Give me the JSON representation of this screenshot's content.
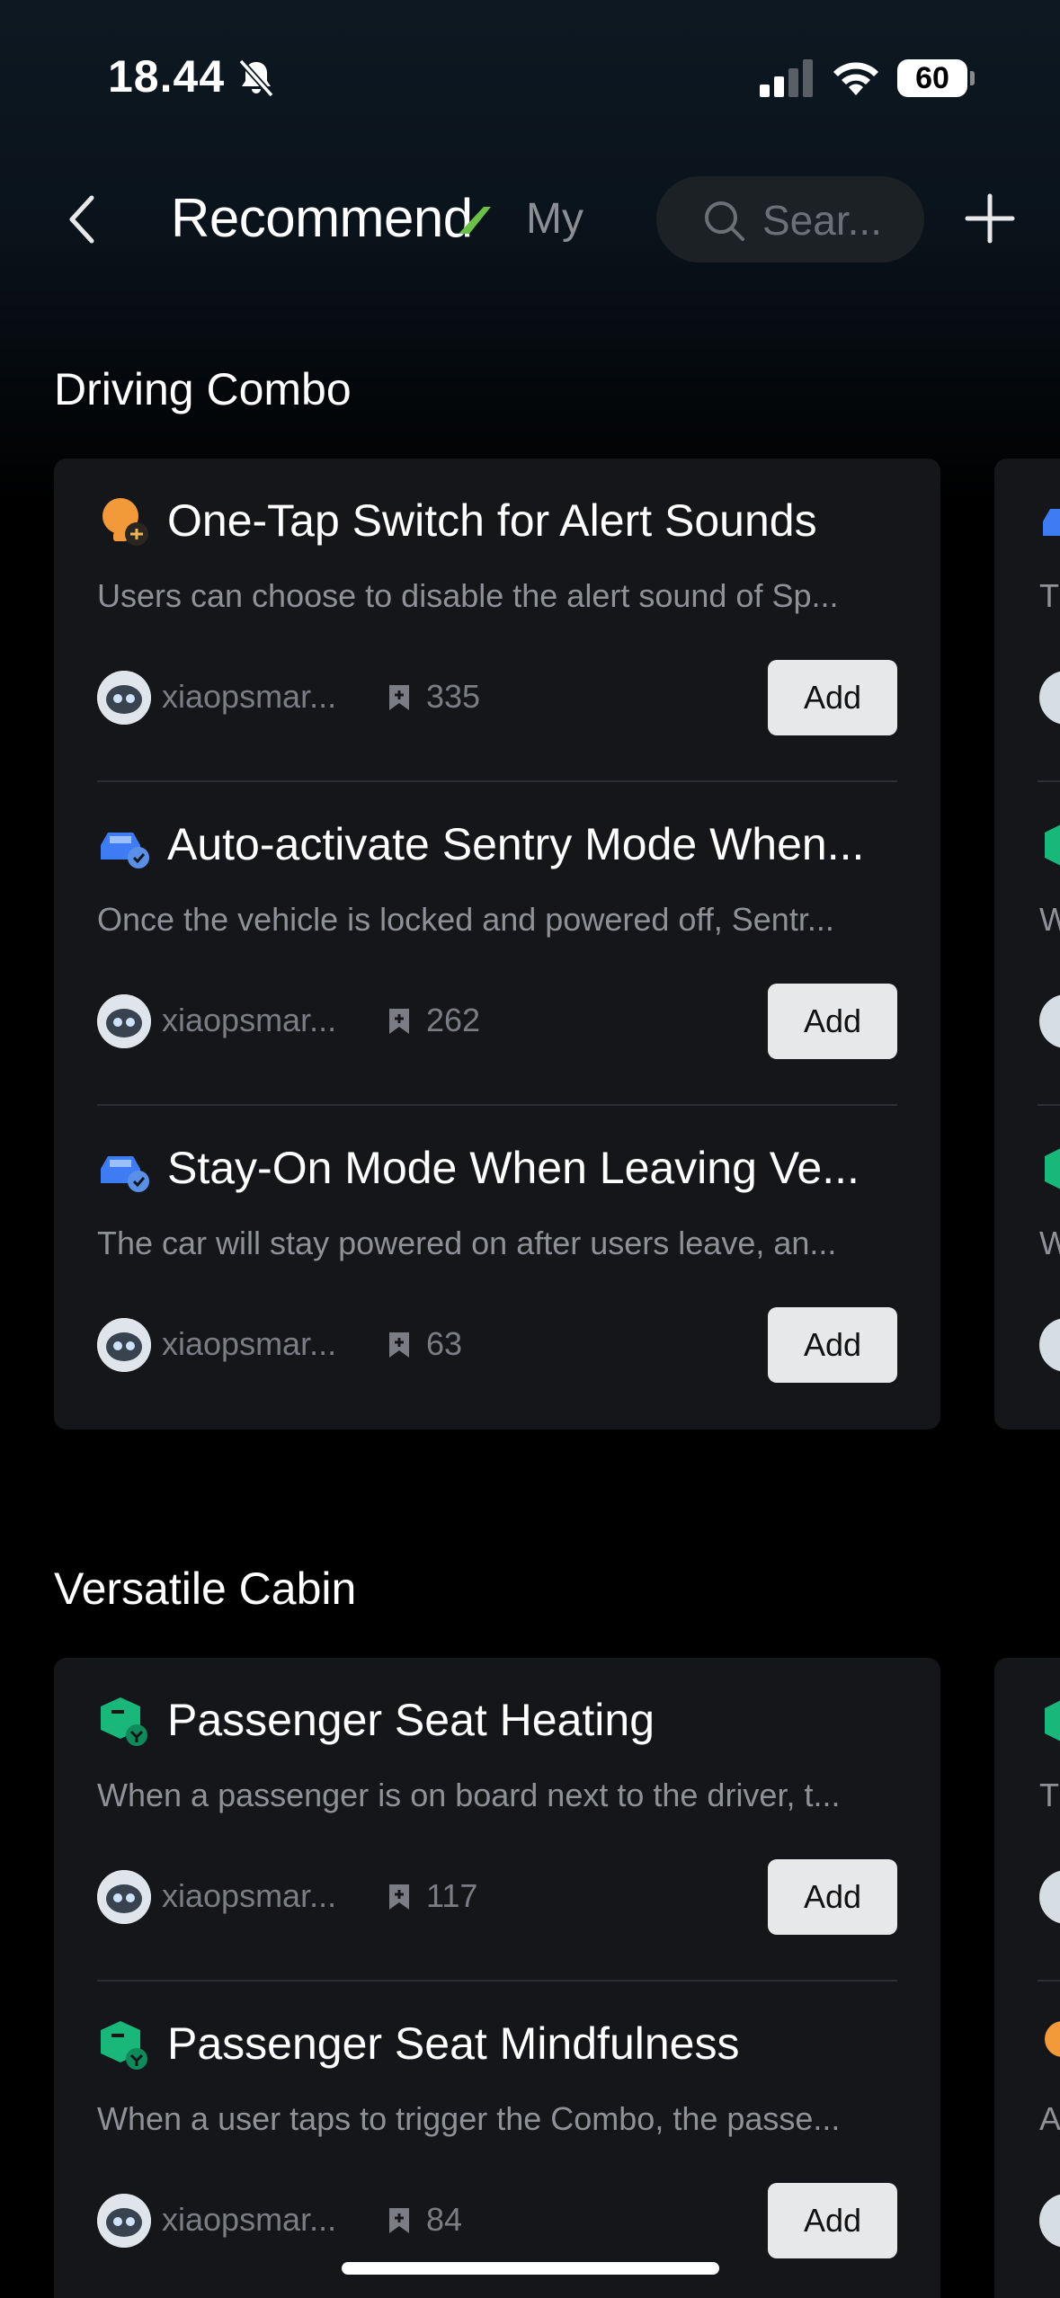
{
  "status_bar": {
    "time": "18.44",
    "battery": "60",
    "icons": [
      "bell-slash-icon",
      "signal-icon",
      "wifi-icon"
    ]
  },
  "nav": {
    "tabs": [
      {
        "label": "Recommend",
        "active": true
      },
      {
        "label": "My",
        "active": false
      }
    ],
    "search_placeholder": "Sear...",
    "icons": [
      "back-icon",
      "search-icon",
      "plus-icon"
    ]
  },
  "sections": [
    {
      "title": "Driving Combo",
      "items": [
        {
          "icon": "bulb-icon",
          "title": "One-Tap Switch for Alert Sounds",
          "description": "Users can choose to disable the alert sound of Sp...",
          "author": "xiaopsmar...",
          "count": "335",
          "button": "Add"
        },
        {
          "icon": "car-icon",
          "title": "Auto-activate Sentry Mode When...",
          "description": "Once the vehicle is locked and powered off, Sentr...",
          "author": "xiaopsmar...",
          "count": "262",
          "button": "Add"
        },
        {
          "icon": "car-icon",
          "title": "Stay-On Mode When Leaving Ve...",
          "description": "The car will stay powered on after users leave, an...",
          "author": "xiaopsmar...",
          "count": "63",
          "button": "Add"
        }
      ],
      "peek": {
        "letter": "T",
        "letters": [
          "W",
          "W"
        ]
      }
    },
    {
      "title": "Versatile Cabin",
      "items": [
        {
          "icon": "seat-cube-icon",
          "title": "Passenger Seat Heating",
          "description": "When a passenger is on board next to the driver, t...",
          "author": "xiaopsmar...",
          "count": "117",
          "button": "Add"
        },
        {
          "icon": "seat-cube-icon",
          "title": "Passenger Seat Mindfulness",
          "description": "When a user taps to trigger the Combo, the passe...",
          "author": "xiaopsmar...",
          "count": "84",
          "button": "Add"
        }
      ],
      "peek": {
        "letter": "T",
        "letters": [
          "A"
        ]
      }
    }
  ],
  "colors": {
    "accent_green": "#6cc04a",
    "car_blue": "#3d7cf2",
    "bulb_orange": "#f2993a",
    "cube_green": "#19b87a"
  }
}
